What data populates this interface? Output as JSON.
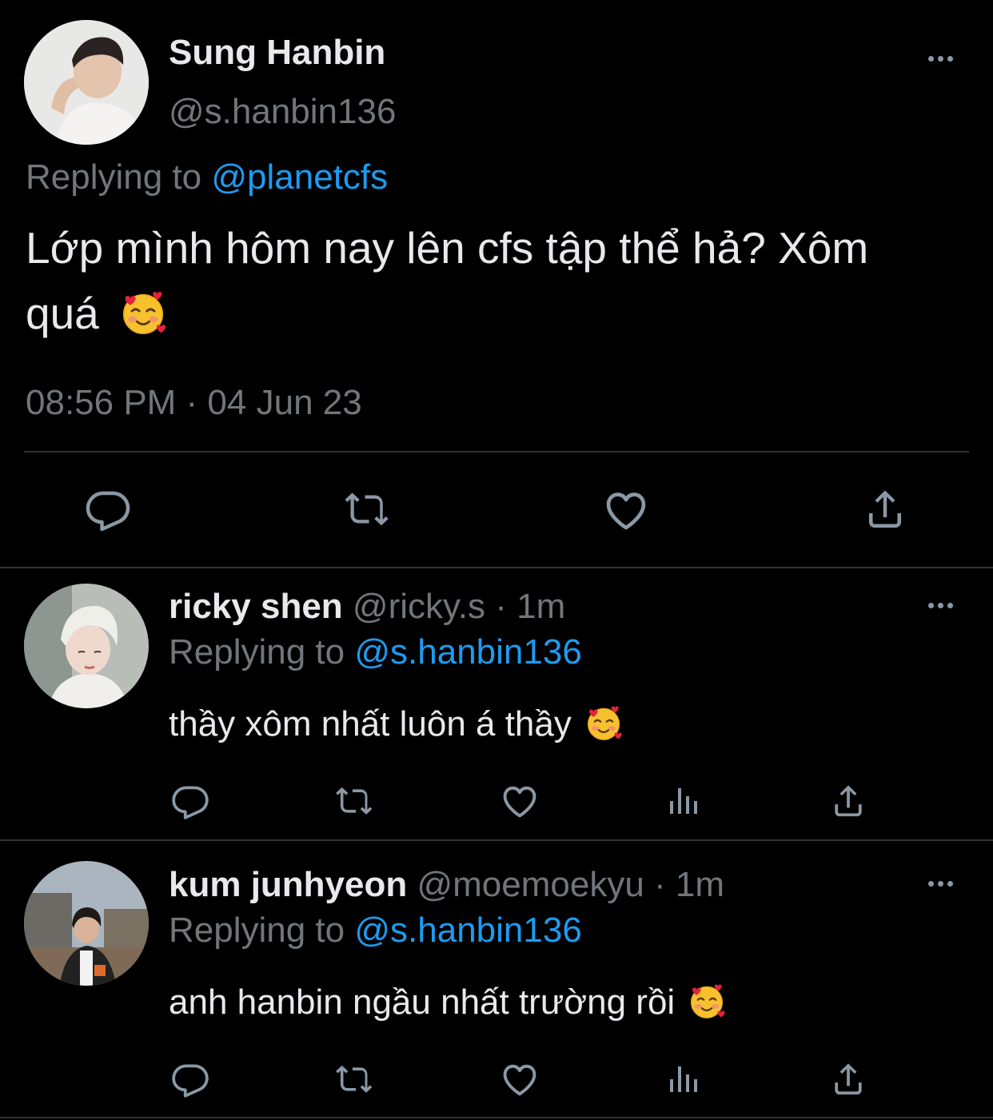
{
  "main_tweet": {
    "author_name": "Sung Hanbin",
    "author_handle": "@s.hanbin136",
    "replying_prefix": "Replying to",
    "replying_handle": "@planetcfs",
    "text_line1": "Lớp mình hôm nay lên cfs tập thể hả? Xôm",
    "text_line2": "quá",
    "timestamp": "08:56 PM · 04 Jun 23"
  },
  "replies": [
    {
      "author_name": "ricky shen",
      "author_handle": "@ricky.s",
      "time": "· 1m",
      "replying_prefix": "Replying to",
      "replying_handle": "@s.hanbin136",
      "text": "thầy xôm nhất luôn á thầy"
    },
    {
      "author_name": "kum junhyeon",
      "author_handle": "@moemoekyu",
      "time": "· 1m",
      "replying_prefix": "Replying to",
      "replying_handle": "@s.hanbin136",
      "text": "anh hanbin ngầu nhất trường rồi"
    }
  ],
  "icons": {
    "reply": "reply-icon",
    "retweet": "retweet-icon",
    "like": "heart-icon",
    "views": "views-icon",
    "share": "share-icon",
    "more": "more-icon",
    "emoji": "smiling-face-with-hearts-emoji"
  },
  "colors": {
    "background": "#000000",
    "text": "#e7e9ea",
    "muted": "#71767b",
    "link": "#1d9bf0",
    "divider": "#2f3336"
  }
}
